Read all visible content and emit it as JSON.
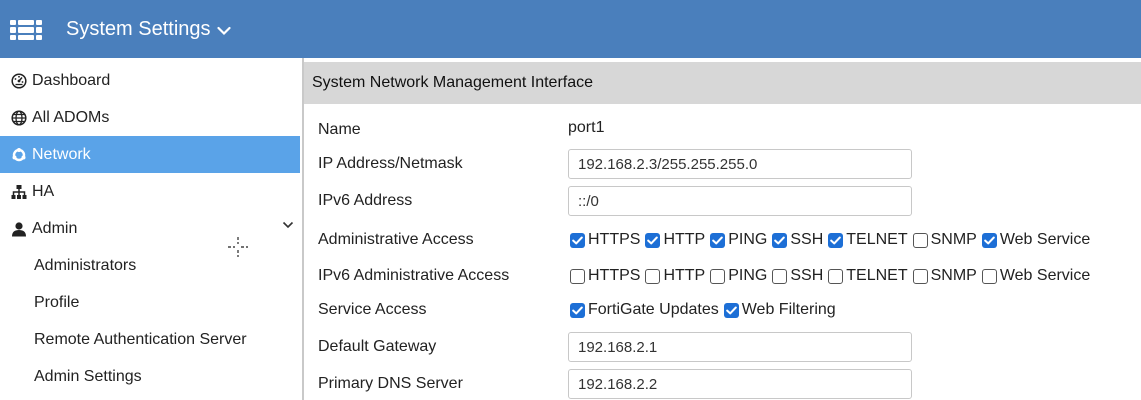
{
  "header": {
    "app_title": "System Settings",
    "accent": "#4a7fbc"
  },
  "sidebar": {
    "items": [
      {
        "label": "Dashboard",
        "icon": "dashboard-icon"
      },
      {
        "label": "All ADOMs",
        "icon": "globe-icon"
      },
      {
        "label": "Network",
        "icon": "network-icon",
        "active": true
      },
      {
        "label": "HA",
        "icon": "ha-icon"
      },
      {
        "label": "Admin",
        "icon": "user-icon",
        "expanded": true
      }
    ],
    "admin_children": [
      "Administrators",
      "Profile",
      "Remote Authentication Server",
      "Admin Settings"
    ],
    "active_color": "#5aa3e8"
  },
  "panel": {
    "title": "System Network Management Interface",
    "name_label": "Name",
    "name_value": "port1",
    "ip_label": "IP Address/Netmask",
    "ip_value": "192.168.2.3/255.255.255.0",
    "ipv6_label": "IPv6 Address",
    "ipv6_value": "::/0",
    "admin_access_label": "Administrative Access",
    "admin_access": [
      {
        "label": "HTTPS",
        "checked": true
      },
      {
        "label": "HTTP",
        "checked": true
      },
      {
        "label": "PING",
        "checked": true
      },
      {
        "label": "SSH",
        "checked": true
      },
      {
        "label": "TELNET",
        "checked": true
      },
      {
        "label": "SNMP",
        "checked": false
      },
      {
        "label": "Web Service",
        "checked": true
      }
    ],
    "ipv6_admin_access_label": "IPv6 Administrative Access",
    "ipv6_admin_access": [
      {
        "label": "HTTPS",
        "checked": false
      },
      {
        "label": "HTTP",
        "checked": false
      },
      {
        "label": "PING",
        "checked": false
      },
      {
        "label": "SSH",
        "checked": false
      },
      {
        "label": "TELNET",
        "checked": false
      },
      {
        "label": "SNMP",
        "checked": false
      },
      {
        "label": "Web Service",
        "checked": false
      }
    ],
    "service_access_label": "Service Access",
    "service_access": [
      {
        "label": "FortiGate Updates",
        "checked": true
      },
      {
        "label": "Web Filtering",
        "checked": true
      }
    ],
    "gateway_label": "Default Gateway",
    "gateway_value": "192.168.2.1",
    "dns_label": "Primary DNS Server",
    "dns_value": "192.168.2.2"
  }
}
